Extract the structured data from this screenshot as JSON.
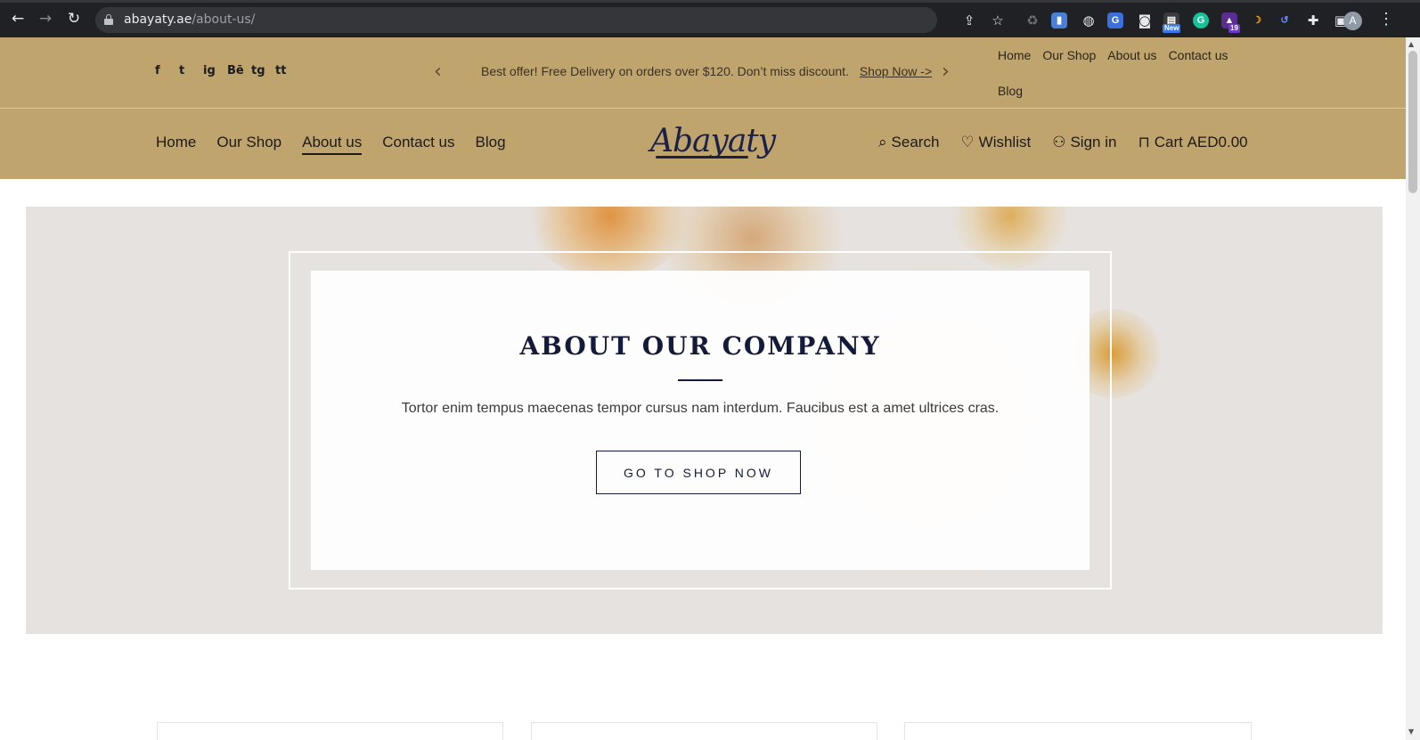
{
  "browser": {
    "url_host": "abayaty.ae",
    "url_path": "/about-us/",
    "profile_initial": "A",
    "ext_new_badge": "New",
    "ext_count_badge": "19"
  },
  "topbar": {
    "social": [
      "f",
      "t",
      "ig",
      "Bē",
      "tg",
      "tt"
    ],
    "promo_text": "Best offer! Free Delivery on orders over $120. Don’t miss discount.",
    "promo_link": "Shop Now ->",
    "nav": [
      "Home",
      "Our Shop",
      "About us",
      "Contact us",
      "Blog"
    ]
  },
  "header": {
    "nav": [
      "Home",
      "Our Shop",
      "About us",
      "Contact us",
      "Blog"
    ],
    "active_nav": "About us",
    "logo": "Abayaty",
    "search_label": "Search",
    "wishlist_label": "Wishlist",
    "signin_label": "Sign in",
    "cart_label": "Cart",
    "cart_total": "AED0.00"
  },
  "hero": {
    "title": "ABOUT OUR COMPANY",
    "text": "Tortor enim tempus maecenas tempor cursus nam interdum. Faucibus est a amet ultrices cras.",
    "button": "GO TO SHOP NOW"
  },
  "colors": {
    "header_bg": "#bfa46e",
    "brand_navy": "#141a3a"
  }
}
